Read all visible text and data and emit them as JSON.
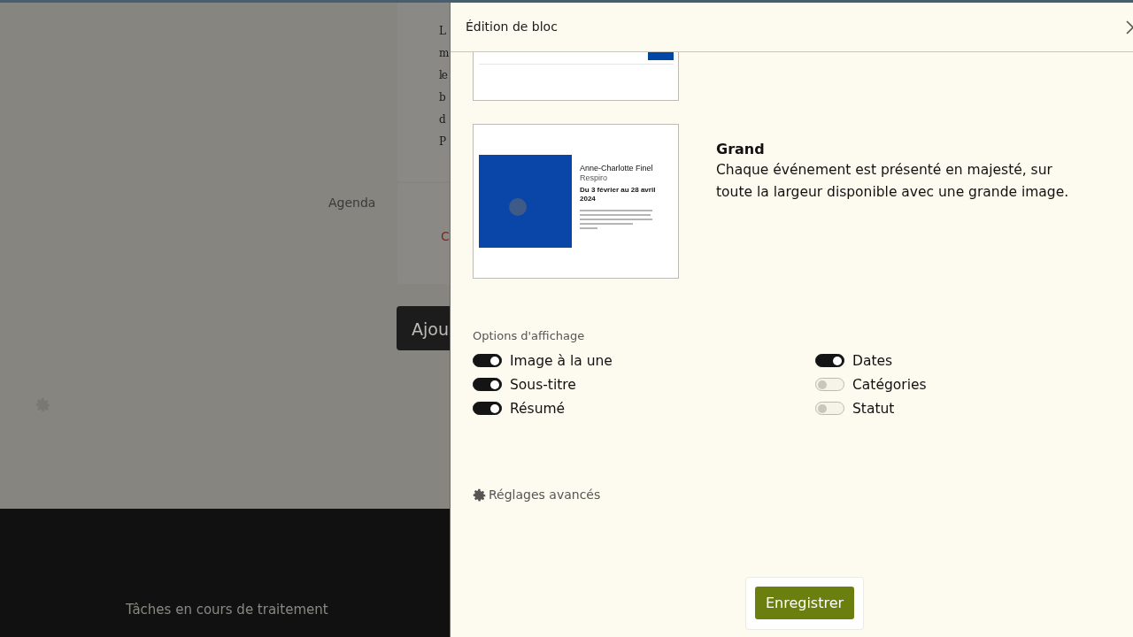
{
  "background_page": {
    "paragraph_lines": [
      "L",
      "m",
      "le",
      "b",
      "d",
      "P"
    ],
    "label": "Agenda",
    "link": "C",
    "button": "Ajou",
    "footer_text": "Tâches en cours de traitement"
  },
  "panel": {
    "title": "Édition de bloc",
    "layouts": [
      {
        "kind": "partial"
      },
      {
        "kind": "large",
        "name": "Grand",
        "description": "Chaque événement est présenté en majesté, sur toute la largeur disponible avec une grande image.",
        "preview": {
          "title": "Anne-Charlotte Finel",
          "subtitle": "Respiro",
          "dates": "Du 3 février au 28 avril 2024"
        }
      }
    ],
    "options": {
      "label": "Options d'affichage",
      "items": [
        {
          "label": "Image à la une",
          "on": true
        },
        {
          "label": "Dates",
          "on": true
        },
        {
          "label": "Sous-titre",
          "on": true
        },
        {
          "label": "Catégories",
          "on": false
        },
        {
          "label": "Résumé",
          "on": true
        },
        {
          "label": "Statut",
          "on": false
        }
      ]
    },
    "advanced": "Réglages avancés",
    "save": "Enregistrer"
  }
}
